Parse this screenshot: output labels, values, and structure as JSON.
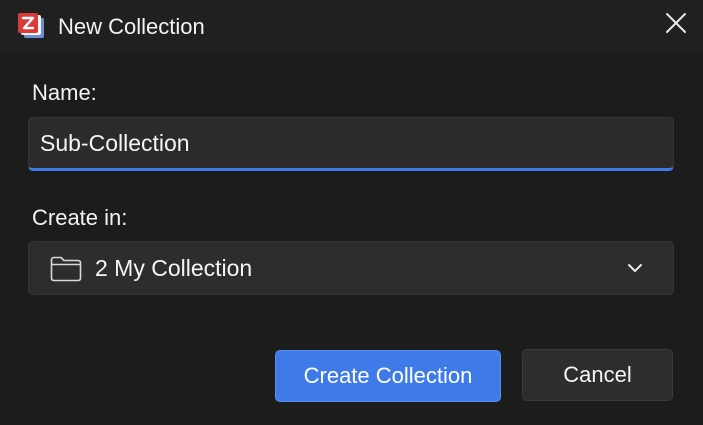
{
  "window": {
    "title": "New Collection",
    "app_icon": "zotero-logo-icon",
    "close_icon": "close-icon"
  },
  "form": {
    "name_label": "Name:",
    "name_value": "Sub-Collection",
    "create_in_label": "Create in:",
    "create_in_value": "2 My Collection",
    "create_in_icon": "folder-icon",
    "dropdown_icon": "chevron-down-icon"
  },
  "buttons": {
    "create_label": "Create Collection",
    "cancel_label": "Cancel"
  },
  "colors": {
    "accent": "#3f7be8",
    "logo_red": "#d93a3a",
    "background": "#1c1c1c"
  }
}
